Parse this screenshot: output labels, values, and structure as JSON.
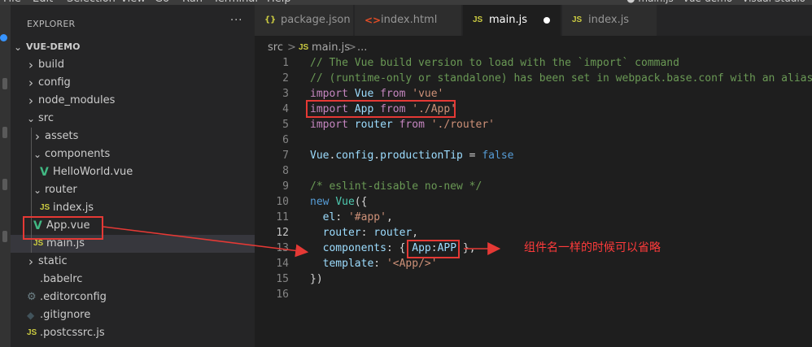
{
  "menu": {
    "items": [
      "File",
      "Edit",
      "Selection",
      "View",
      "Go",
      "Run",
      "Terminal",
      "Help"
    ],
    "window_title": "● main.js - vue-demo - Visual Studio"
  },
  "sidebar": {
    "title": "EXPLORER",
    "more": "···",
    "root": "VUE-DEMO",
    "items": [
      {
        "label": "build",
        "kind": "folder",
        "expanded": false,
        "depth": 1
      },
      {
        "label": "config",
        "kind": "folder",
        "expanded": false,
        "depth": 1
      },
      {
        "label": "node_modules",
        "kind": "folder",
        "expanded": false,
        "depth": 1
      },
      {
        "label": "src",
        "kind": "folder",
        "expanded": true,
        "depth": 1
      },
      {
        "label": "assets",
        "kind": "folder",
        "expanded": false,
        "depth": 2
      },
      {
        "label": "components",
        "kind": "folder",
        "expanded": true,
        "depth": 2
      },
      {
        "label": "HelloWorld.vue",
        "kind": "vue",
        "depth": 3
      },
      {
        "label": "router",
        "kind": "folder",
        "expanded": true,
        "depth": 2
      },
      {
        "label": "index.js",
        "kind": "js",
        "depth": 3
      },
      {
        "label": "App.vue",
        "kind": "vue",
        "depth": 2
      },
      {
        "label": "main.js",
        "kind": "js",
        "depth": 2,
        "selected": true
      },
      {
        "label": "static",
        "kind": "folder",
        "expanded": false,
        "depth": 1
      },
      {
        "label": ".babelrc",
        "kind": "babel",
        "depth": 1
      },
      {
        "label": ".editorconfig",
        "kind": "gear",
        "depth": 1
      },
      {
        "label": ".gitignore",
        "kind": "git",
        "depth": 1
      },
      {
        "label": ".postcssrc.js",
        "kind": "js",
        "depth": 1
      }
    ]
  },
  "tabs": [
    {
      "icon": "{}",
      "label": "package.json",
      "active": false
    },
    {
      "icon": "<>",
      "label": "index.html",
      "active": false
    },
    {
      "icon": "JS",
      "label": "main.js",
      "active": true,
      "dirty": true
    },
    {
      "icon": "JS",
      "label": "index.js",
      "active": false
    }
  ],
  "breadcrumb": {
    "folder": "src",
    "sep": ">",
    "icon": "JS",
    "file": "main.js",
    "symbol": "..."
  },
  "code": {
    "current_line": 12,
    "lines": [
      {
        "n": "1",
        "tokens": [
          [
            "c-com",
            "// The Vue build version to load with the `import` command"
          ]
        ]
      },
      {
        "n": "2",
        "tokens": [
          [
            "c-com",
            "// (runtime-only or standalone) has been set in webpack.base.conf with an alias."
          ]
        ]
      },
      {
        "n": "3",
        "tokens": [
          [
            "c-kw",
            "import "
          ],
          [
            "c-var",
            "Vue "
          ],
          [
            "c-kw",
            "from "
          ],
          [
            "c-str",
            "'vue'"
          ]
        ]
      },
      {
        "n": "4",
        "tokens": [
          [
            "c-kw",
            "import "
          ],
          [
            "c-var",
            "App "
          ],
          [
            "c-kw",
            "from "
          ],
          [
            "c-str",
            "'./App'"
          ]
        ]
      },
      {
        "n": "5",
        "tokens": [
          [
            "c-kw",
            "import "
          ],
          [
            "c-var",
            "router "
          ],
          [
            "c-kw",
            "from "
          ],
          [
            "c-str",
            "'./router'"
          ]
        ]
      },
      {
        "n": "6",
        "tokens": []
      },
      {
        "n": "7",
        "tokens": [
          [
            "c-var",
            "Vue"
          ],
          [
            "c-pun",
            "."
          ],
          [
            "c-prop",
            "config"
          ],
          [
            "c-pun",
            "."
          ],
          [
            "c-prop",
            "productionTip"
          ],
          [
            "c-pun",
            " = "
          ],
          [
            "c-bool",
            "false"
          ]
        ]
      },
      {
        "n": "8",
        "tokens": []
      },
      {
        "n": "9",
        "tokens": [
          [
            "c-com",
            "/* eslint-disable no-new */"
          ]
        ]
      },
      {
        "n": "10",
        "tokens": [
          [
            "c-new",
            "new "
          ],
          [
            "c-cls",
            "Vue"
          ],
          [
            "c-pun",
            "({"
          ]
        ]
      },
      {
        "n": "11",
        "tokens": [
          [
            "c-pun",
            "  "
          ],
          [
            "c-prop",
            "el"
          ],
          [
            "c-pun",
            ": "
          ],
          [
            "c-str",
            "'#app'"
          ],
          [
            "c-pun",
            ","
          ]
        ]
      },
      {
        "n": "12",
        "tokens": [
          [
            "c-pun",
            "  "
          ],
          [
            "c-prop",
            "router"
          ],
          [
            "c-pun",
            ": "
          ],
          [
            "c-var",
            "router"
          ],
          [
            "c-pun",
            ","
          ]
        ]
      },
      {
        "n": "13",
        "tokens": [
          [
            "c-pun",
            "  "
          ],
          [
            "c-prop",
            "components"
          ],
          [
            "c-pun",
            ": { "
          ],
          [
            "c-prop",
            "App"
          ],
          [
            "c-pun",
            ":"
          ],
          [
            "c-var",
            "APP"
          ],
          [
            "c-pun",
            " },"
          ]
        ]
      },
      {
        "n": "14",
        "tokens": [
          [
            "c-pun",
            "  "
          ],
          [
            "c-prop",
            "template"
          ],
          [
            "c-pun",
            ": "
          ],
          [
            "c-str",
            "'<App/>'"
          ]
        ]
      },
      {
        "n": "15",
        "tokens": [
          [
            "c-pun",
            "})"
          ]
        ]
      },
      {
        "n": "16",
        "tokens": []
      }
    ]
  },
  "annotation": {
    "text": "组件名一样的时候可以省略",
    "color": "#ff3b3b"
  },
  "colors": {
    "highlight_box": "#e53935",
    "accent": "#3794ff"
  }
}
